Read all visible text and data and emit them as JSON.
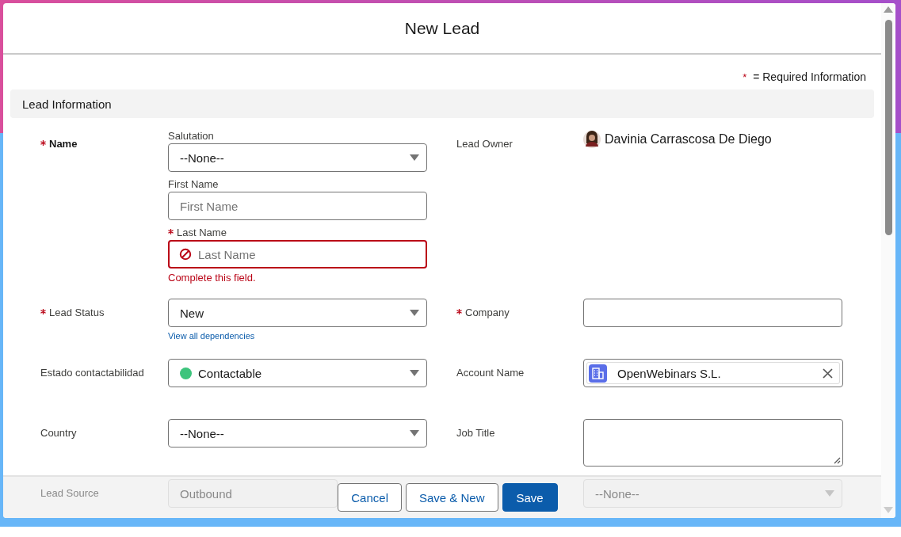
{
  "modal": {
    "title": "New Lead"
  },
  "required_note": {
    "mark": "*",
    "text": "= Required Information"
  },
  "section": {
    "title": "Lead Information"
  },
  "rows": [
    {
      "left": {
        "kind": "name",
        "label": "Name",
        "required": true,
        "parts": [
          {
            "kind": "select",
            "label": "Salutation",
            "required": false,
            "value": "--None--"
          },
          {
            "kind": "text",
            "label": "First Name",
            "required": false,
            "placeholder": "First Name",
            "error": false
          },
          {
            "kind": "text",
            "label": "Last Name",
            "required": true,
            "placeholder": "Last Name",
            "error": true,
            "error_text": "Complete this field."
          }
        ]
      },
      "right": {
        "kind": "owner",
        "label": "Lead Owner",
        "required": false,
        "value": "Davinia Carrascosa De Diego"
      }
    },
    {
      "left": {
        "kind": "select",
        "label": "Lead Status",
        "required": true,
        "value": "New",
        "link": "View all dependencies"
      },
      "right": {
        "kind": "text",
        "label": "Company",
        "required": true,
        "error": false
      }
    },
    {
      "left": {
        "kind": "select",
        "label": "Estado contactabilidad",
        "required": false,
        "value": "Contactable",
        "color": "#3cc47c"
      },
      "right": {
        "kind": "lookup",
        "label": "Account Name",
        "required": false,
        "value": "OpenWebinars S.L."
      }
    },
    {
      "left": {
        "kind": "select",
        "label": "Country",
        "required": false,
        "value": "--None--"
      },
      "right": {
        "kind": "textarea",
        "label": "Job Title",
        "required": false
      }
    },
    {
      "left": {
        "kind": "text",
        "label": "Lead Source",
        "required": false,
        "value": "Outbound",
        "disabled": true,
        "error": false
      },
      "right": {
        "kind": "select",
        "value": "--None--",
        "disabled": true
      }
    }
  ],
  "buttons": [
    {
      "label": "Cancel",
      "kind": "neutral"
    },
    {
      "label": "Save & New",
      "kind": "neutral"
    },
    {
      "label": "Save",
      "kind": "brand"
    }
  ]
}
